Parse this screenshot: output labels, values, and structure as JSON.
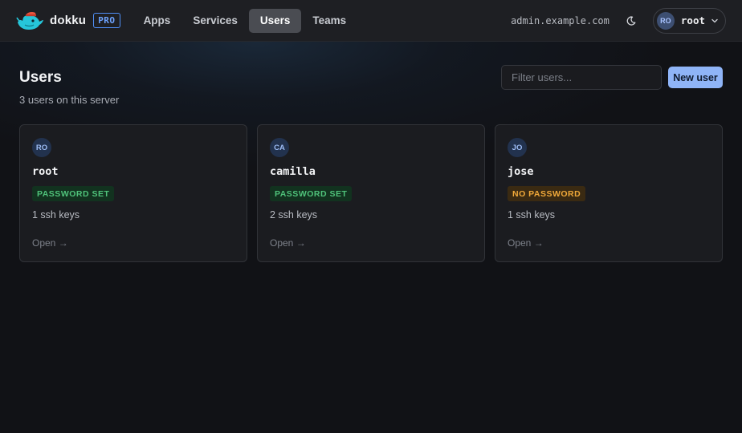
{
  "header": {
    "brand_name": "dokku",
    "pro_label": "PRO",
    "nav": [
      {
        "label": "Apps"
      },
      {
        "label": "Services"
      },
      {
        "label": "Users",
        "active": true
      },
      {
        "label": "Teams"
      }
    ],
    "host": "admin.example.com",
    "theme_icon": "moon-icon",
    "user": {
      "initials": "RO",
      "name": "root"
    }
  },
  "page": {
    "title": "Users",
    "subtitle": "3 users on this server",
    "filter_placeholder": "Filter users...",
    "new_user_label": "New user"
  },
  "users": [
    {
      "initials": "RO",
      "name": "root",
      "status": "PASSWORD SET",
      "status_kind": "ok",
      "keys": "1 ssh keys",
      "open": "Open →"
    },
    {
      "initials": "CA",
      "name": "camilla",
      "status": "PASSWORD SET",
      "status_kind": "ok",
      "keys": "2 ssh keys",
      "open": "Open →"
    },
    {
      "initials": "JO",
      "name": "jose",
      "status": "NO PASSWORD",
      "status_kind": "warn",
      "keys": "1 ssh keys",
      "open": "Open →"
    }
  ],
  "colors": {
    "accent": "#8fb4f7",
    "status_ok": "#4fc27a",
    "status_warn": "#f0a93a",
    "background": "#111216"
  }
}
